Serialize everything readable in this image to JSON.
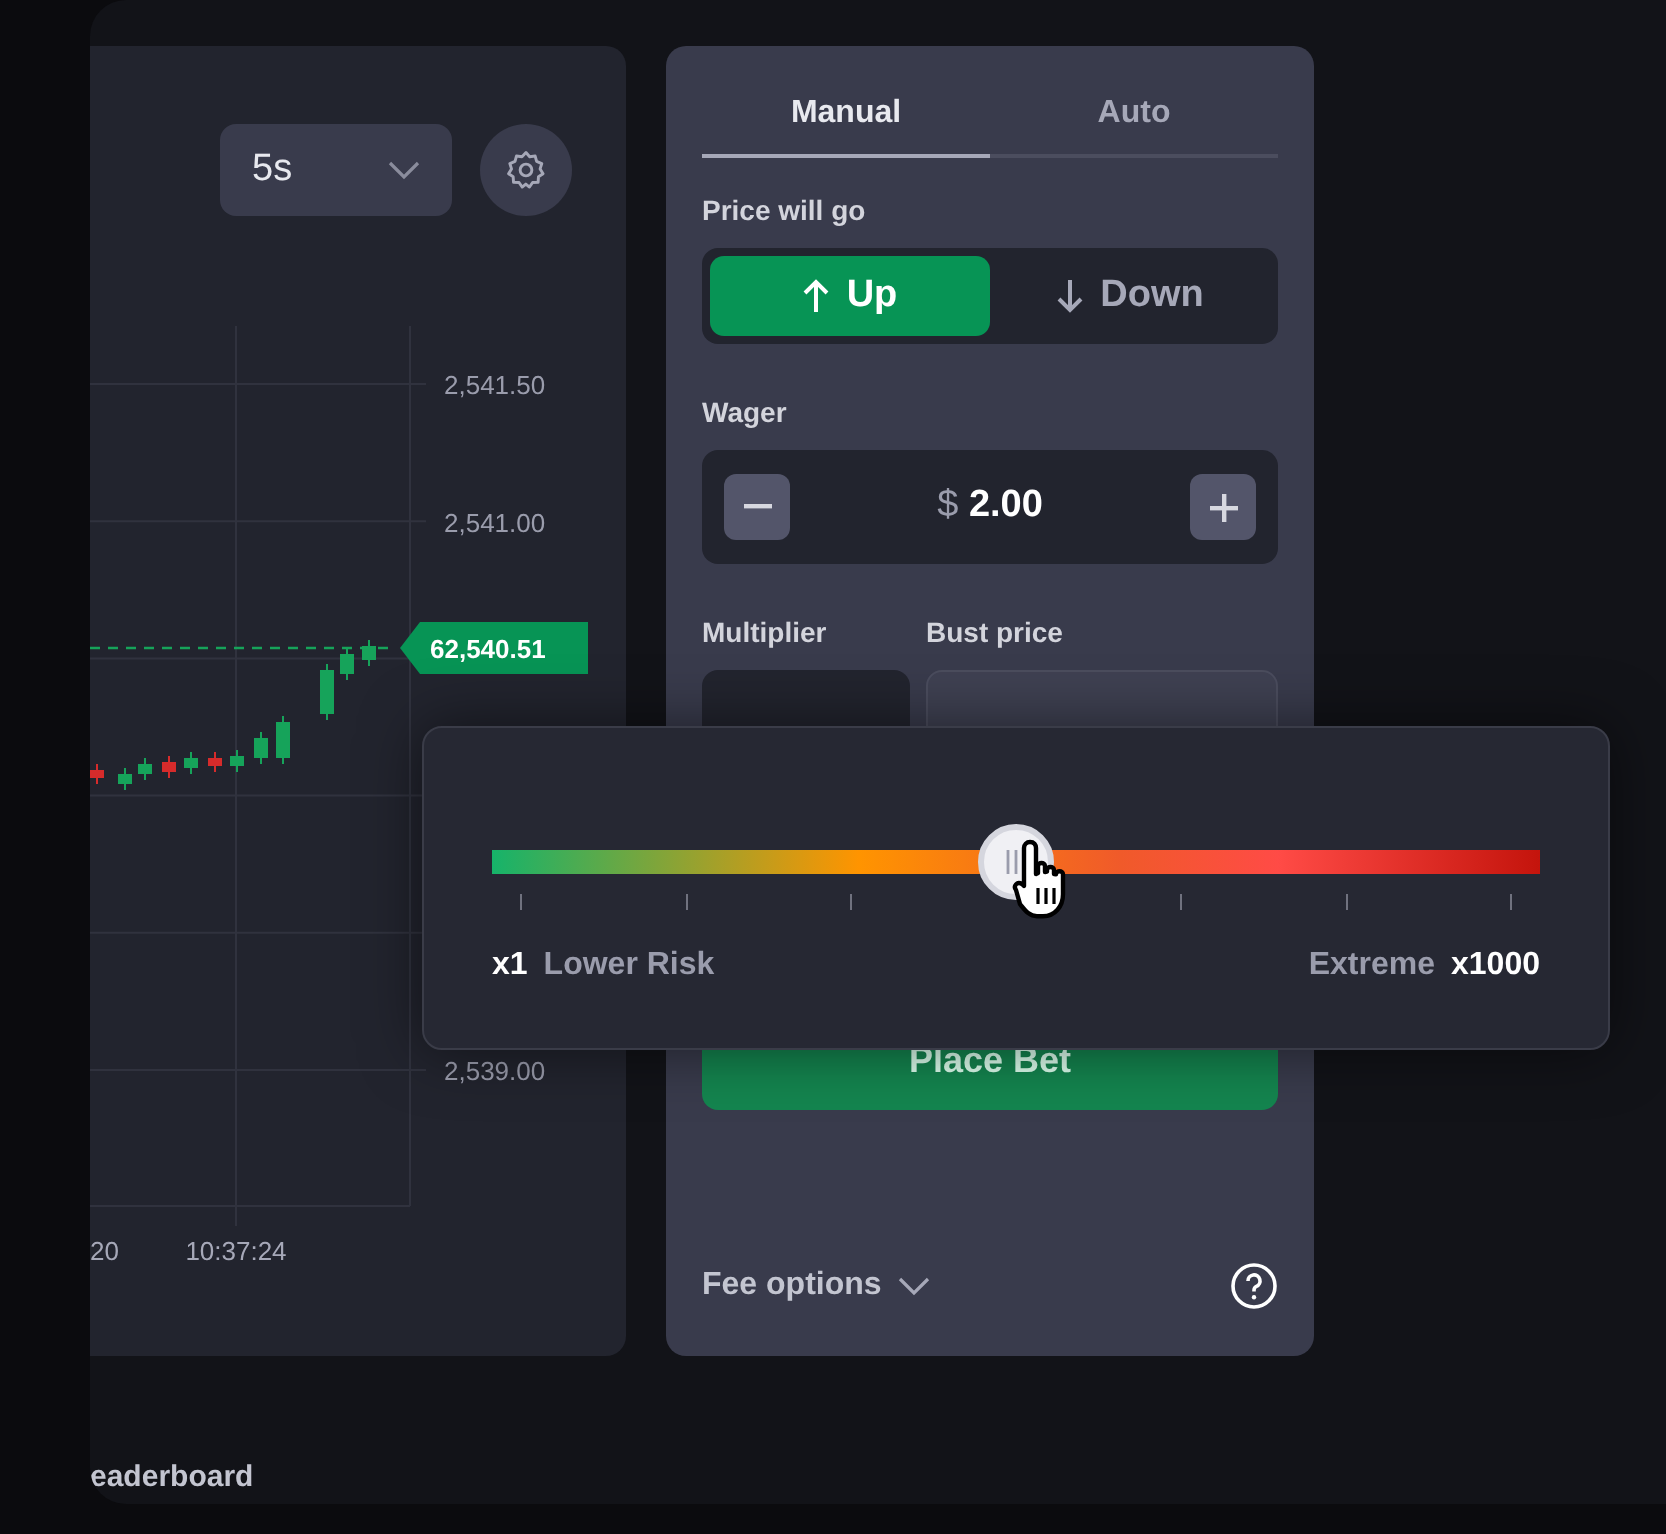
{
  "chart_panel": {
    "interval_select": {
      "value": "5s"
    },
    "price_labels": [
      "2,541.50",
      "2,541.00",
      "2,539.00"
    ],
    "current_price": "62,540.51",
    "time_labels": [
      "20",
      "10:37:24"
    ]
  },
  "bet_panel": {
    "tabs": [
      {
        "label": "Manual",
        "selected": true
      },
      {
        "label": "Auto",
        "selected": false
      }
    ],
    "direction_label": "Price will go",
    "direction_options": [
      {
        "label": "Up",
        "selected": true
      },
      {
        "label": "Down",
        "selected": false
      }
    ],
    "wager_label": "Wager",
    "wager": {
      "currency": "$",
      "amount": "2.00"
    },
    "multiplier_label": "Multiplier",
    "bust_price_label": "Bust price",
    "place_bet_button": "Place Bet",
    "fee_options": "Fee options"
  },
  "multiplier_popup": {
    "level": 0.5,
    "min_value": "x1",
    "min_caption": "Lower Risk",
    "max_caption": "Extreme",
    "max_value": "x1000"
  },
  "leaderboard_heading": "eaderboard"
}
